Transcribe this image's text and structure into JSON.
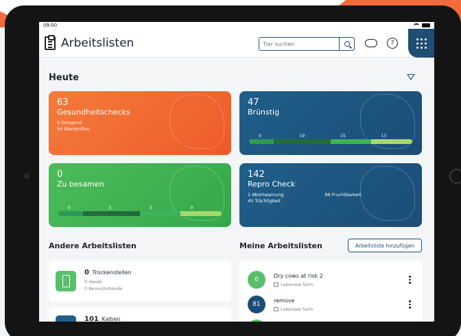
{
  "status_bar": {
    "time": "09:00"
  },
  "header": {
    "title": "Arbeitslisten",
    "search_placeholder": "Tier suchen",
    "help_label": "?"
  },
  "colors": {
    "orange": "#ee5a2a",
    "blue": "#1b4d76",
    "green": "#34a84a",
    "light_green": "#a7d96a"
  },
  "today": {
    "title": "Heute",
    "cards": [
      {
        "count": "63",
        "label": "Gesundheitschecks",
        "lines": [
          "9 Dringend",
          "54 Überprüfen"
        ]
      },
      {
        "count": "47",
        "label": "Brünstig",
        "bar_values": [
          "0",
          "19",
          "15",
          "13"
        ]
      },
      {
        "count": "0",
        "label": "Zu besamen",
        "bar_values": [
          "0",
          "0",
          "0",
          "0"
        ]
      },
      {
        "count": "142",
        "label": "Repro Check",
        "lines": [
          "1 Abortwarnung",
          "45 Trächtigkeit"
        ],
        "right_line": "96 Fruchtbarkeit"
      }
    ]
  },
  "other_lists": {
    "title": "Andere Arbeitslisten",
    "items": [
      {
        "count": "0",
        "name": "Trockenstellen",
        "lines": [
          "0 Heute",
          "0 Bevorstehende"
        ]
      },
      {
        "count": "101",
        "name": "Kalben"
      }
    ]
  },
  "my_lists": {
    "title": "Meine Arbeitslisten",
    "add_button": "Arbeitsliste hinzufügen",
    "items": [
      {
        "badge": "0",
        "name": "Dry cows at risk 2",
        "farm": "Lakeview farm"
      },
      {
        "badge": "81",
        "name": "remove",
        "farm": "Lakeview farm"
      }
    ]
  }
}
